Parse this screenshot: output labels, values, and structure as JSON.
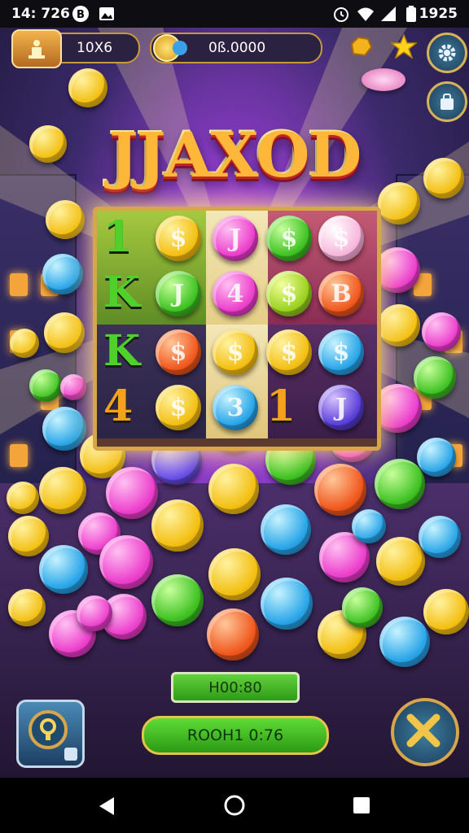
{
  "status_bar": {
    "time": "14: 726",
    "right_time": "1925",
    "icons_left": [
      "circle-b-icon",
      "photo-icon"
    ],
    "icons_right": [
      "alarm-icon",
      "wifi-icon",
      "signal-icon",
      "battery-icon"
    ]
  },
  "hud": {
    "level_value": "10X6",
    "coins_value": "0ß.0000",
    "icons": [
      "gold-nugget-icon",
      "star-icon",
      "gear-icon",
      "bag-icon",
      "trophy-icon",
      "gem-icon"
    ]
  },
  "title": "JJAXOD",
  "board": {
    "rows": [
      [
        "1",
        "$",
        "J",
        "$",
        "$"
      ],
      [
        "K",
        "J",
        "4",
        "$",
        "B"
      ],
      [
        "K",
        "$",
        "$",
        "$",
        "$"
      ],
      [
        "4",
        "$",
        "3",
        "1",
        "J"
      ]
    ]
  },
  "footer": {
    "counter_value": "H00:80",
    "room_label": "ROOH1 0:76"
  },
  "colors": {
    "gold": "#f5c524",
    "accent_green": "#3fc223",
    "accent_pink": "#ee3fc8",
    "frame_gold": "#d7a64a"
  },
  "nav": {
    "icons": [
      "back-icon",
      "home-icon",
      "recents-icon"
    ]
  }
}
